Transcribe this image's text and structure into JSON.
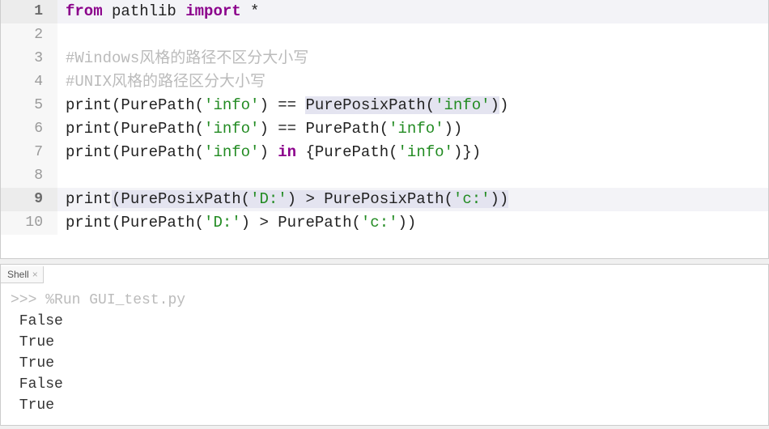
{
  "editor": {
    "lines": [
      {
        "num": 1,
        "hl": true,
        "kind": "import",
        "kw1": "from",
        "mod": " pathlib ",
        "kw2": "import",
        "rest": " *"
      },
      {
        "num": 2,
        "hl": false,
        "kind": "blank",
        "text": ""
      },
      {
        "num": 3,
        "hl": false,
        "kind": "comment",
        "text": "#Windows风格的路径不区分大小写"
      },
      {
        "num": 4,
        "hl": false,
        "kind": "comment",
        "text": "#UNIX风格的路径区分大小写"
      },
      {
        "num": 5,
        "hl": false,
        "kind": "code5",
        "print": "print",
        "fn1": "PurePath",
        "s1": "'info'",
        "op": " == ",
        "fn2": "PurePosixPath",
        "s2": "'info'"
      },
      {
        "num": 6,
        "hl": false,
        "kind": "code6",
        "print": "print",
        "fn1": "PurePath",
        "s1": "'info'",
        "op": " == ",
        "fn2": "PurePath",
        "s2": "'info'"
      },
      {
        "num": 7,
        "hl": false,
        "kind": "code7",
        "print": "print",
        "fn1": "PurePath",
        "s1": "'info'",
        "op": " in ",
        "fn2": "PurePath",
        "s2": "'info'"
      },
      {
        "num": 8,
        "hl": false,
        "kind": "blank",
        "text": ""
      },
      {
        "num": 9,
        "hl": true,
        "kind": "code9",
        "print": "print",
        "fn1": "PurePosixPath",
        "s1": "'D:'",
        "op": " > ",
        "fn2": "PurePosixPath",
        "s2": "'c:'"
      },
      {
        "num": 10,
        "hl": false,
        "kind": "code10",
        "print": "print",
        "fn1": "PurePath",
        "s1": "'D:'",
        "op": " > ",
        "fn2": "PurePath",
        "s2": "'c:'"
      }
    ]
  },
  "shell": {
    "tab_label": "Shell",
    "tab_close": "×",
    "prompt": ">>> ",
    "run_cmd": "%Run GUI_test.py",
    "output": [
      " False",
      " True",
      " True",
      " False",
      " True"
    ]
  }
}
